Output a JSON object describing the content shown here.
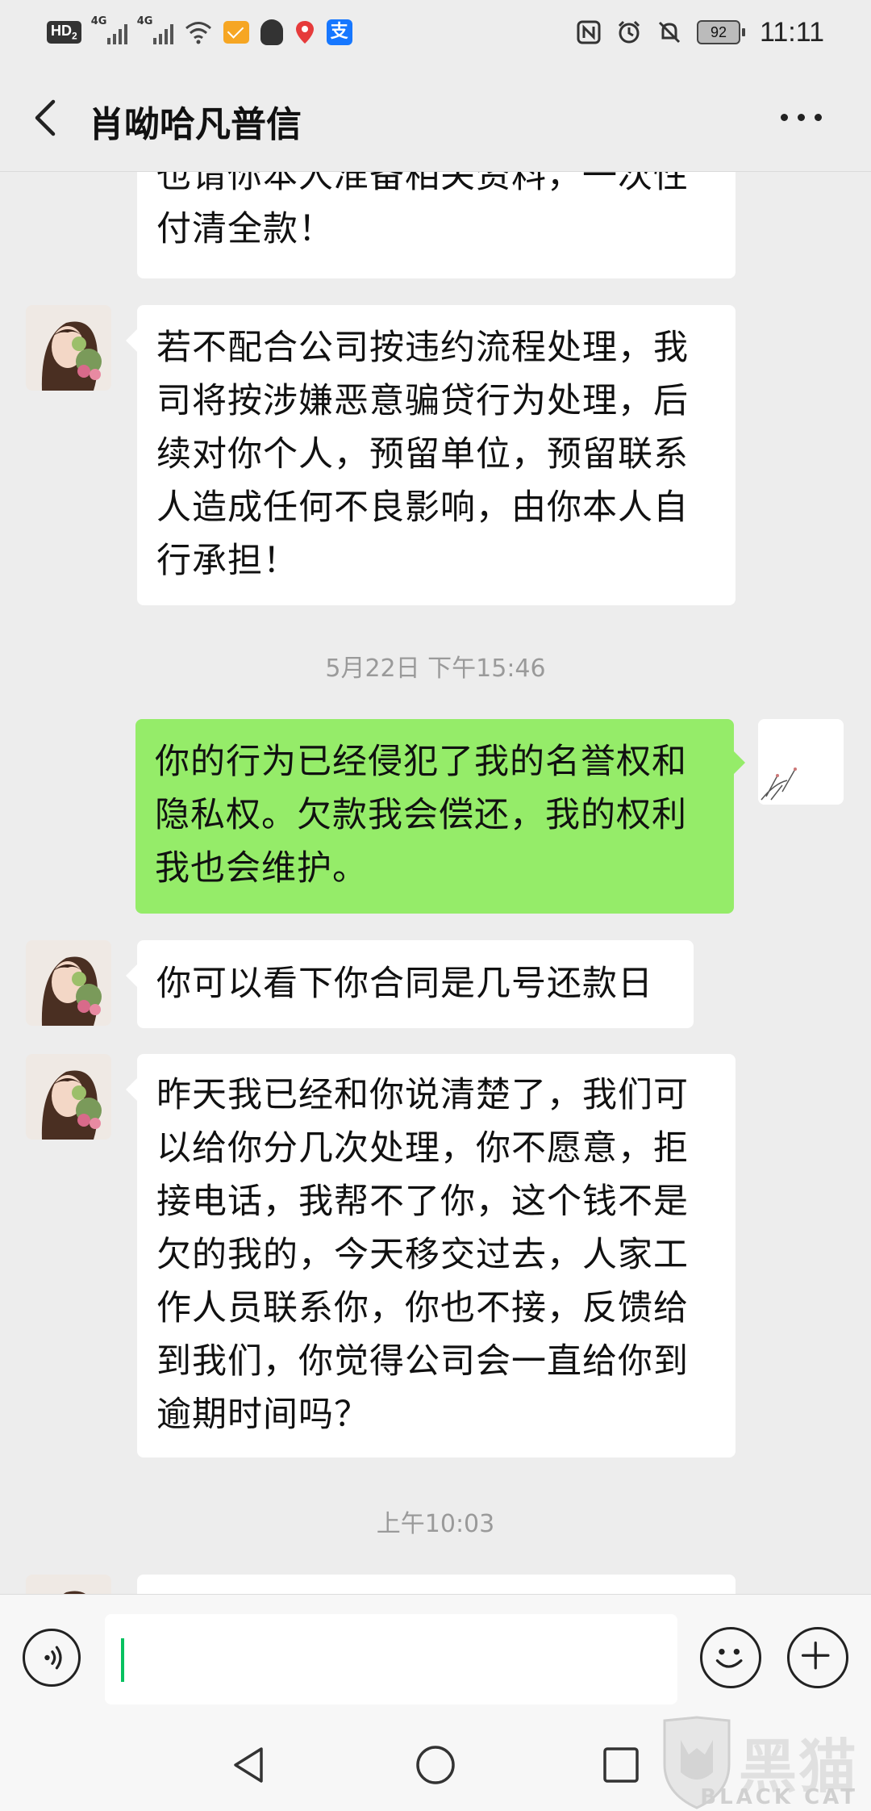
{
  "status_bar": {
    "hd_label": "HD",
    "hd_sub": "2",
    "net1": "4G",
    "net2": "4G",
    "battery": "92",
    "time": "11:11"
  },
  "header": {
    "title": "肖呦哈凡普信"
  },
  "messages": [
    {
      "side": "in",
      "text": "也请你本人准备相关资料，一次性付清全款！"
    },
    {
      "side": "in",
      "text": "若不配合公司按违约流程处理，我司将按涉嫌恶意骗贷行为处理，后续对你个人，预留单位，预留联系人造成任何不良影响，由你本人自行承担！"
    },
    {
      "side": "timestamp",
      "text": "5月22日 下午15:46"
    },
    {
      "side": "out",
      "text": "你的行为已经侵犯了我的名誉权和隐私权。欠款我会偿还，我的权利我也会维护。"
    },
    {
      "side": "in",
      "text": "你可以看下你合同是几号还款日"
    },
    {
      "side": "in",
      "text": "昨天我已经和你说清楚了，我们可以给你分几次处理，你不愿意，拒接电话，我帮不了你，这个钱不是欠的我的，今天移交过去，人家工作人员联系你，你也不接，反馈给到我们，你觉得公司会一直给你到逾期时间吗？"
    },
    {
      "side": "timestamp",
      "text": "上午10:03"
    }
  ],
  "bubble_lines": {
    "m0": [
      "也请你本人准备相关资料，一次性",
      "付清全款！"
    ],
    "m1": [
      "若不配合公司按违约流程处理，我",
      "司将按涉嫌恶意骗贷行为处理，后",
      "续对你个人，预留单位，预留联系",
      "人造成任何不良影响，由你本人自",
      "行承担！"
    ],
    "m3": [
      "你的行为已经侵犯了我的名誉权和",
      "隐私权。欠款我会偿还，我的权利",
      "我也会维护。"
    ],
    "m4": [
      "你可以看下你合同是几号还款日"
    ],
    "m5": [
      "昨天我已经和你说清楚了，我们可",
      "以给你分几次处理，你不愿意，拒",
      "接电话，我帮不了你，这个钱不是",
      "欠的我的，今天移交过去，人家工",
      "作人员联系你，你也不接，反馈给",
      "到我们，你觉得公司会一直给你到",
      "逾期时间吗？"
    ]
  },
  "icons": {
    "back": "chevron-left-icon",
    "more": "more-dots-icon",
    "voice": "voice-input-icon",
    "emoji": "emoji-icon",
    "plus": "plus-icon",
    "nav_back": "triangle-back-icon",
    "nav_home": "circle-home-icon",
    "nav_recent": "square-recent-icon"
  },
  "watermark": {
    "text": "黑猫",
    "sub": "BLACK CAT"
  },
  "colors": {
    "background": "#ededed",
    "incoming_bubble": "#ffffff",
    "outgoing_bubble": "#95ec69",
    "cursor": "#07c160"
  }
}
